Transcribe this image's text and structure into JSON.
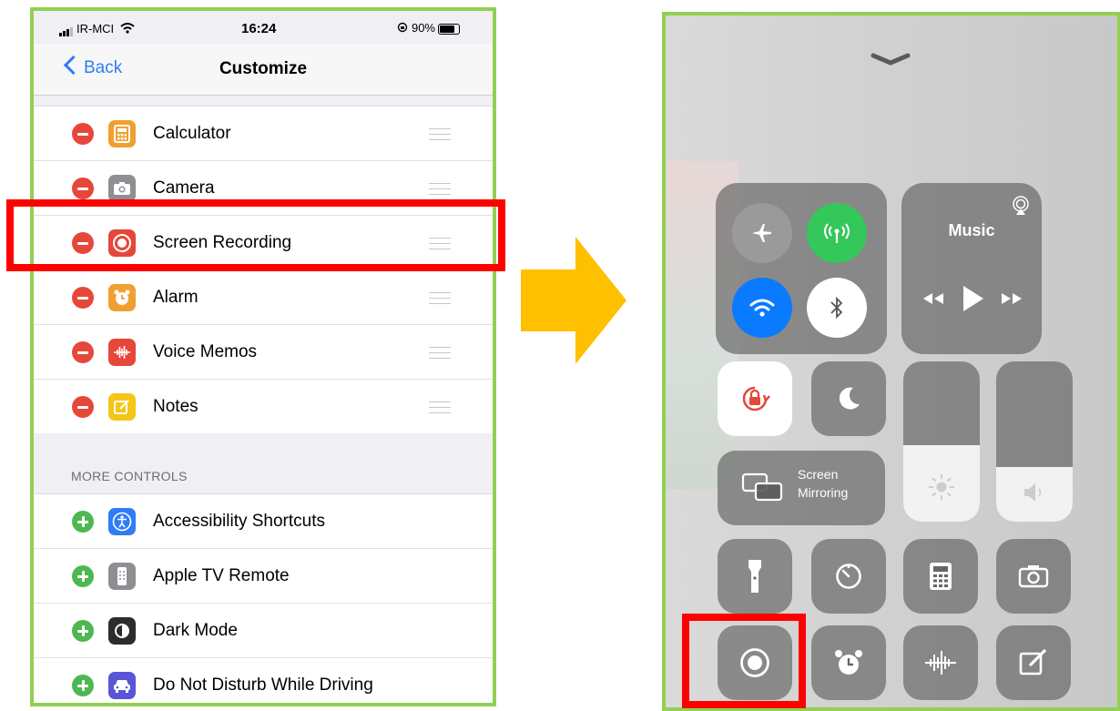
{
  "left_screen": {
    "status_bar": {
      "carrier": "IR-MCI",
      "time": "16:24",
      "battery": "90%"
    },
    "nav": {
      "back_label": "Back",
      "title": "Customize"
    },
    "included": [
      {
        "label": "Calculator",
        "icon": "calculator-icon",
        "color": "#f0a030"
      },
      {
        "label": "Camera",
        "icon": "camera-icon",
        "color": "#8e8e93"
      },
      {
        "label": "Screen Recording",
        "icon": "screen-recording-icon",
        "color": "#e5473a"
      },
      {
        "label": "Alarm",
        "icon": "alarm-icon",
        "color": "#f0a030"
      },
      {
        "label": "Voice Memos",
        "icon": "voice-memos-icon",
        "color": "#e5473a"
      },
      {
        "label": "Notes",
        "icon": "notes-icon",
        "color": "#f5c518"
      }
    ],
    "more_header": "MORE CONTROLS",
    "more": [
      {
        "label": "Accessibility Shortcuts",
        "icon": "accessibility-icon",
        "color": "#2f7cf6"
      },
      {
        "label": "Apple TV Remote",
        "icon": "tv-remote-icon",
        "color": "#8e8e93"
      },
      {
        "label": "Dark Mode",
        "icon": "dark-mode-icon",
        "color": "#2c2c2e"
      },
      {
        "label": "Do Not Disturb While Driving",
        "icon": "car-icon",
        "color": "#5856d6"
      }
    ]
  },
  "right_screen": {
    "music_label": "Music",
    "mirroring_line1": "Screen",
    "mirroring_line2": "Mirroring",
    "brightness_level": 0.48,
    "volume_level": 0.34,
    "colors": {
      "cellular": "#34c759",
      "wifi": "#0a7aff",
      "highlight": "#ff0000",
      "frame": "#92d050",
      "arrow": "#ffc000"
    }
  }
}
